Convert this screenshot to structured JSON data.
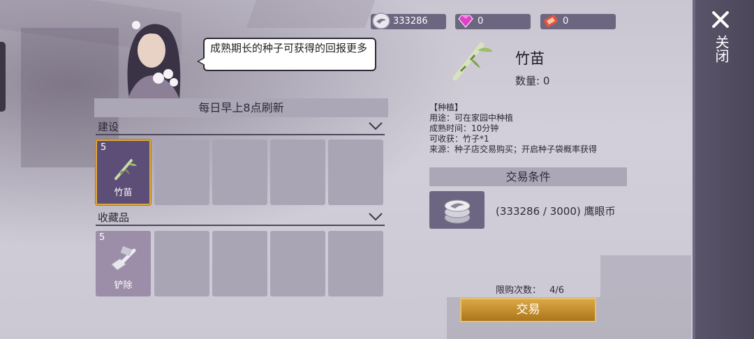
{
  "currencies": [
    {
      "icon": "eagle-coin-icon",
      "value": "333286"
    },
    {
      "icon": "diamond-icon",
      "value": "0"
    },
    {
      "icon": "ticket-icon",
      "value": "0"
    }
  ],
  "close": {
    "label": "关闭"
  },
  "npc": {
    "speech": "成熟期长的种子可获得的回报更多"
  },
  "shop": {
    "refresh_text": "每日早上8点刷新",
    "categories": [
      {
        "label": "建设",
        "items": [
          {
            "name": "竹苗",
            "count": "5",
            "icon": "bamboo-icon"
          }
        ]
      },
      {
        "label": "收藏品",
        "items": [
          {
            "name": "铲除",
            "count": "5",
            "icon": "shovel-icon"
          }
        ]
      }
    ]
  },
  "detail": {
    "name": "竹苗",
    "quantity": "数量: 0",
    "desc_lines": [
      "【种植】",
      "用途：可在家园中种植",
      "成熟时间：10分钟",
      "可收获：竹子*1",
      "来源：种子店交易购买；开启种子袋概率获得"
    ],
    "trade_title": "交易条件",
    "requirement": "(333286 / 3000) 鹰眼币",
    "limit_label": "限购次数：",
    "limit_value": "4/6",
    "trade_button": "交易"
  },
  "colors": {
    "accent_gold": "#c08a2a",
    "panel": "#aaa5b5",
    "selected_slot": "#5d4e78"
  }
}
